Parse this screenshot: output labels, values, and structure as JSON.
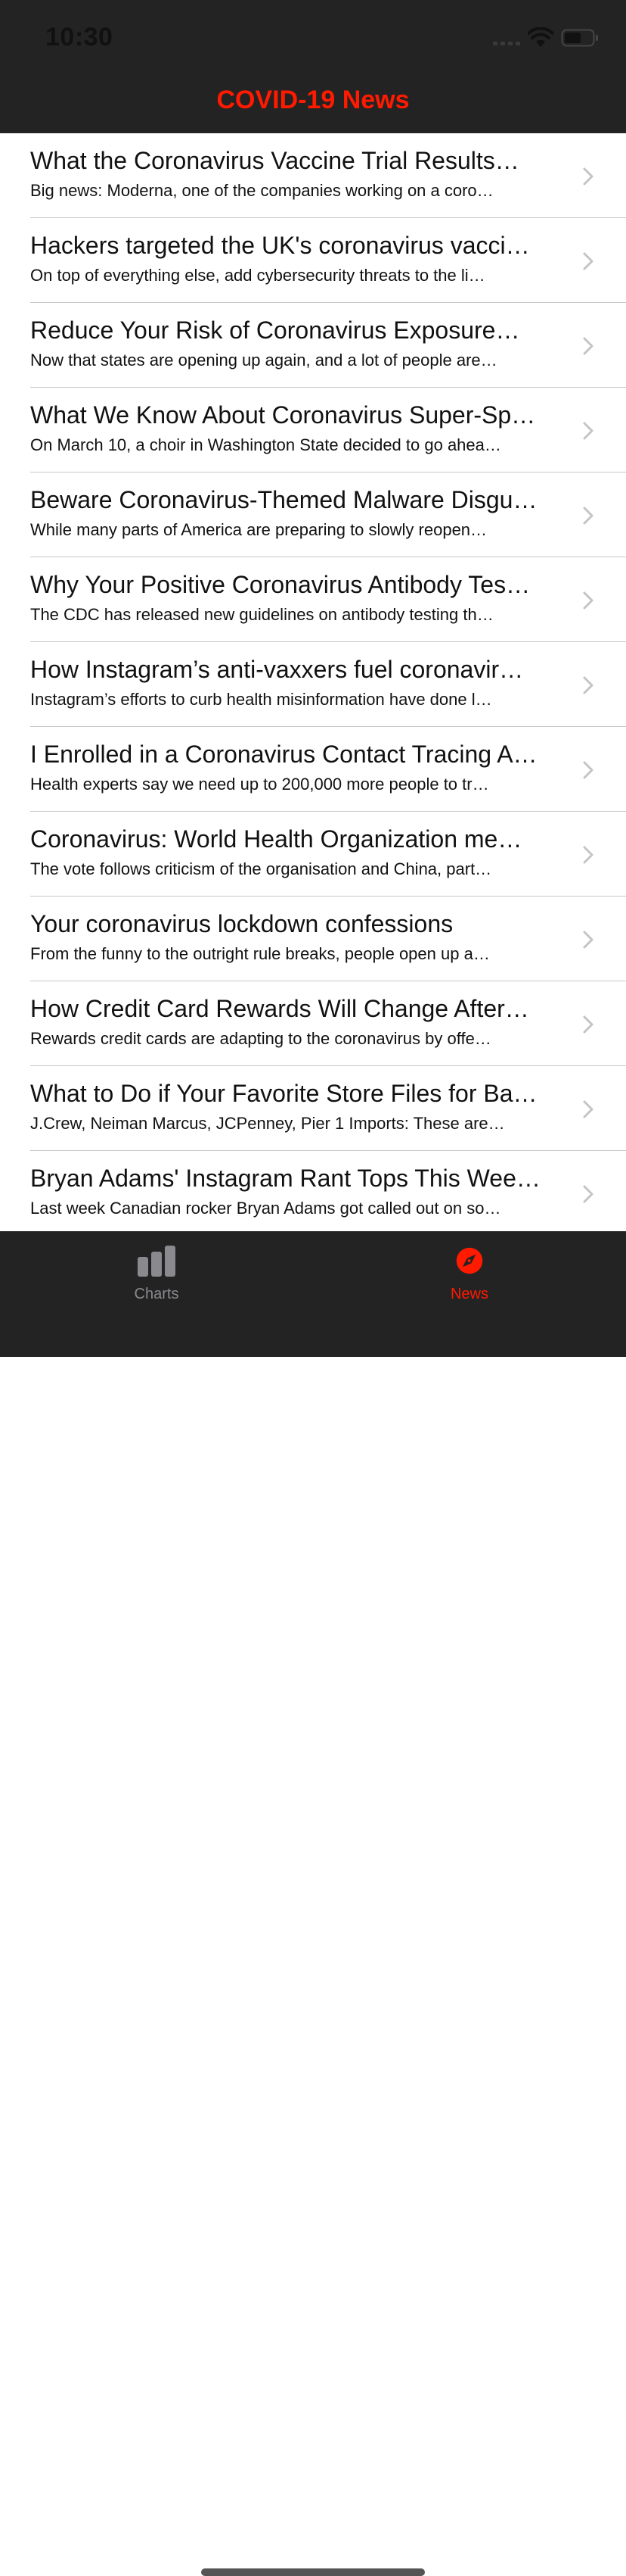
{
  "status_bar": {
    "time": "10:30"
  },
  "nav": {
    "title": "COVID-19 News"
  },
  "colors": {
    "accent": "#ff1a00",
    "bar_background": "#232323",
    "inactive_tab": "#8a8a8e"
  },
  "news": [
    {
      "title": "What the Coronavirus Vaccine Trial Results…",
      "summary": "Big news: Moderna, one of the companies working on a coro…"
    },
    {
      "title": "Hackers targeted the UK's coronavirus vacci…",
      "summary": "On top of everything else, add cybersecurity threats to the li…"
    },
    {
      "title": "Reduce Your Risk of Coronavirus Exposure…",
      "summary": "Now that states are opening up again, and a lot of people are…"
    },
    {
      "title": "What We Know About Coronavirus Super-Sp…",
      "summary": "On March 10, a choir in Washington State decided to go ahea…"
    },
    {
      "title": "Beware Coronavirus-Themed Malware Disgu…",
      "summary": "While many parts of America are preparing to slowly reopen…"
    },
    {
      "title": "Why Your Positive Coronavirus Antibody Tes…",
      "summary": "The CDC has released new guidelines on antibody testing th…"
    },
    {
      "title": "How Instagram’s anti-vaxxers fuel coronavir…",
      "summary": "Instagram’s efforts to curb health misinformation have done l…"
    },
    {
      "title": "I Enrolled in a Coronavirus Contact Tracing A…",
      "summary": "Health experts say we need up to 200,000 more people to tr…"
    },
    {
      "title": "Coronavirus: World Health Organization me…",
      "summary": "The vote follows criticism of the organisation and China, part…"
    },
    {
      "title": "Your coronavirus lockdown confessions",
      "summary": "From the funny to the outright rule breaks, people open up a…"
    },
    {
      "title": "How Credit Card Rewards Will Change After…",
      "summary": "Rewards credit cards are adapting to the coronavirus by offe…"
    },
    {
      "title": "What to Do if Your Favorite Store Files for Ba…",
      "summary": "J.Crew, Neiman Marcus, JCPenney, Pier 1 Imports: These are…"
    },
    {
      "title": "Bryan Adams' Instagram Rant Tops This Wee…",
      "summary": "Last week Canadian rocker Bryan Adams got called out on so…"
    }
  ],
  "tabs": [
    {
      "label": "Charts",
      "icon": "bar-chart-icon",
      "selected": false
    },
    {
      "label": "News",
      "icon": "compass-icon",
      "selected": true
    }
  ]
}
